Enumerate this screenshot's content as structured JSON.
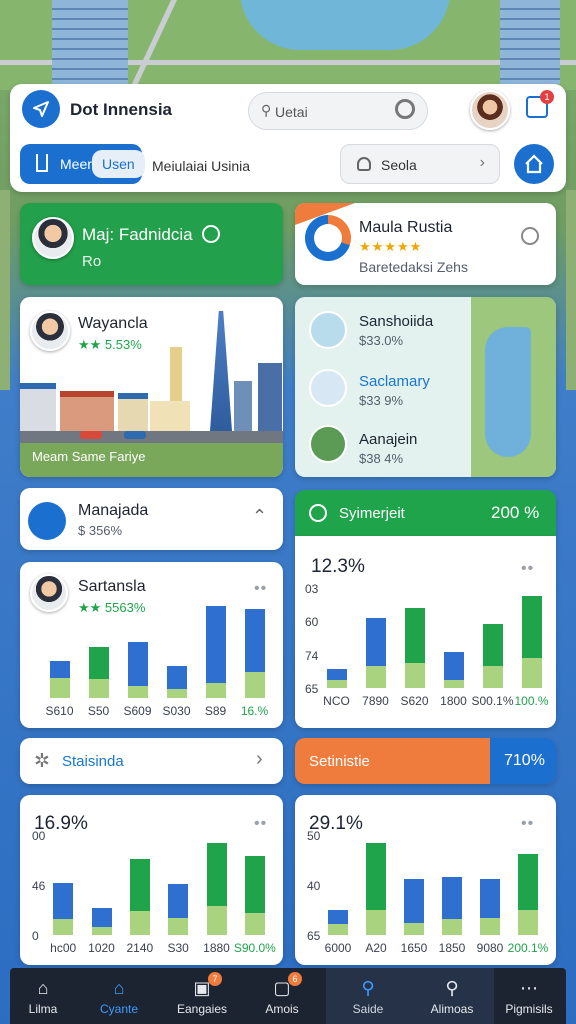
{
  "header": {
    "app_title": "Dot Innensia",
    "search_placeholder": "Uetai",
    "notification_count": "1"
  },
  "tabs": {
    "active_label_1": "Meer",
    "active_label_2": "Usen",
    "inactive_label": "Meiulaiai Usinia",
    "search_label": "Seola"
  },
  "cards": {
    "promo_green": {
      "title": "Maj: Fadnidcia",
      "subtitle": "Ro"
    },
    "rating_card": {
      "title": "Maula Rustia",
      "stars": "★★★★★",
      "subtitle": "Baretedaksi Zehs"
    },
    "city_card": {
      "title": "Wayancla",
      "stat": "★★ 5.53%",
      "caption": "Meam Same Fariye"
    },
    "list_card": {
      "items": [
        {
          "title": "Sanshoiida",
          "value": "$33.0%"
        },
        {
          "title": "Saclamary",
          "value": "$33 9%"
        },
        {
          "title": "Aanajein",
          "value": "$38 4%"
        }
      ]
    },
    "manajada": {
      "title": "Manajada",
      "value": "$ 356%"
    },
    "symerjeit": {
      "title": "Syimerjeit",
      "value": "200 %"
    },
    "statsinda": {
      "title": "Staisinda"
    },
    "setinistie": {
      "title": "Setinistie",
      "value": "710%"
    }
  },
  "charts_text": {
    "sartansla": {
      "title": "Sartansla",
      "stat": "★★ 5563%"
    },
    "c2_headline": "12.3%",
    "c3_headline": "16.9%",
    "c4_headline": "29.1%"
  },
  "chart_data": [
    {
      "type": "bar",
      "categories": [
        "S610",
        "S50",
        "S609",
        "S030",
        "S89",
        "16.%"
      ],
      "series": [
        {
          "values": [
            1.0,
            1.9,
            2.6,
            1.4,
            4.5,
            3.7
          ]
        },
        {
          "values": [
            1.2,
            1.1,
            0.7,
            0.5,
            0.9,
            1.5
          ]
        }
      ]
    },
    {
      "type": "bar",
      "categories": [
        "NCO",
        "7890",
        "S620",
        "1800",
        "S00.1%",
        "100.%"
      ],
      "yticks": [
        "03",
        "60",
        "74",
        "65"
      ],
      "series": [
        {
          "values": [
            0.7,
            3.1,
            3.5,
            1.8,
            2.7,
            4.0
          ]
        },
        {
          "values": [
            0.5,
            1.4,
            1.6,
            0.5,
            1.4,
            1.9
          ]
        }
      ]
    },
    {
      "type": "bar",
      "categories": [
        "hc00",
        "1020",
        "2140",
        "S30",
        "1880",
        "S90.0%"
      ],
      "yticks": [
        "00",
        "46",
        "0"
      ],
      "series": [
        {
          "values": [
            2.3,
            1.2,
            3.3,
            2.1,
            4.0,
            3.6
          ]
        },
        {
          "values": [
            1.0,
            0.5,
            1.5,
            1.1,
            1.8,
            1.4
          ]
        }
      ]
    },
    {
      "type": "bar",
      "categories": [
        "6000",
        "A20",
        "1850",
        "9080",
        "200.1%"
      ],
      "yticks": [
        "50",
        "40",
        "65"
      ],
      "series": [
        {
          "values": [
            0.9,
            4.3,
            2.8,
            2.7,
            2.5,
            3.6
          ]
        },
        {
          "values": [
            0.7,
            1.6,
            0.8,
            1.0,
            1.1,
            1.6
          ]
        }
      ],
      "extra_categories": [
        "1650"
      ]
    }
  ],
  "bottom_nav": [
    {
      "label": "Lilma",
      "icon": "home-icon"
    },
    {
      "label": "Cyante",
      "icon": "house-icon"
    },
    {
      "label": "Eangaies",
      "icon": "square-icon"
    },
    {
      "label": "Amois",
      "icon": "box-icon"
    },
    {
      "label": "Saide",
      "icon": "search-icon"
    },
    {
      "label": "Alimoas",
      "icon": "search-icon"
    },
    {
      "label": "Pigmisils",
      "icon": "more-icon"
    }
  ],
  "nav_badges": {
    "eangaies": "7",
    "amois": "6"
  },
  "colors": {
    "primary": "#1877d2",
    "green": "#20a44b",
    "orange": "#ef7b3c"
  }
}
